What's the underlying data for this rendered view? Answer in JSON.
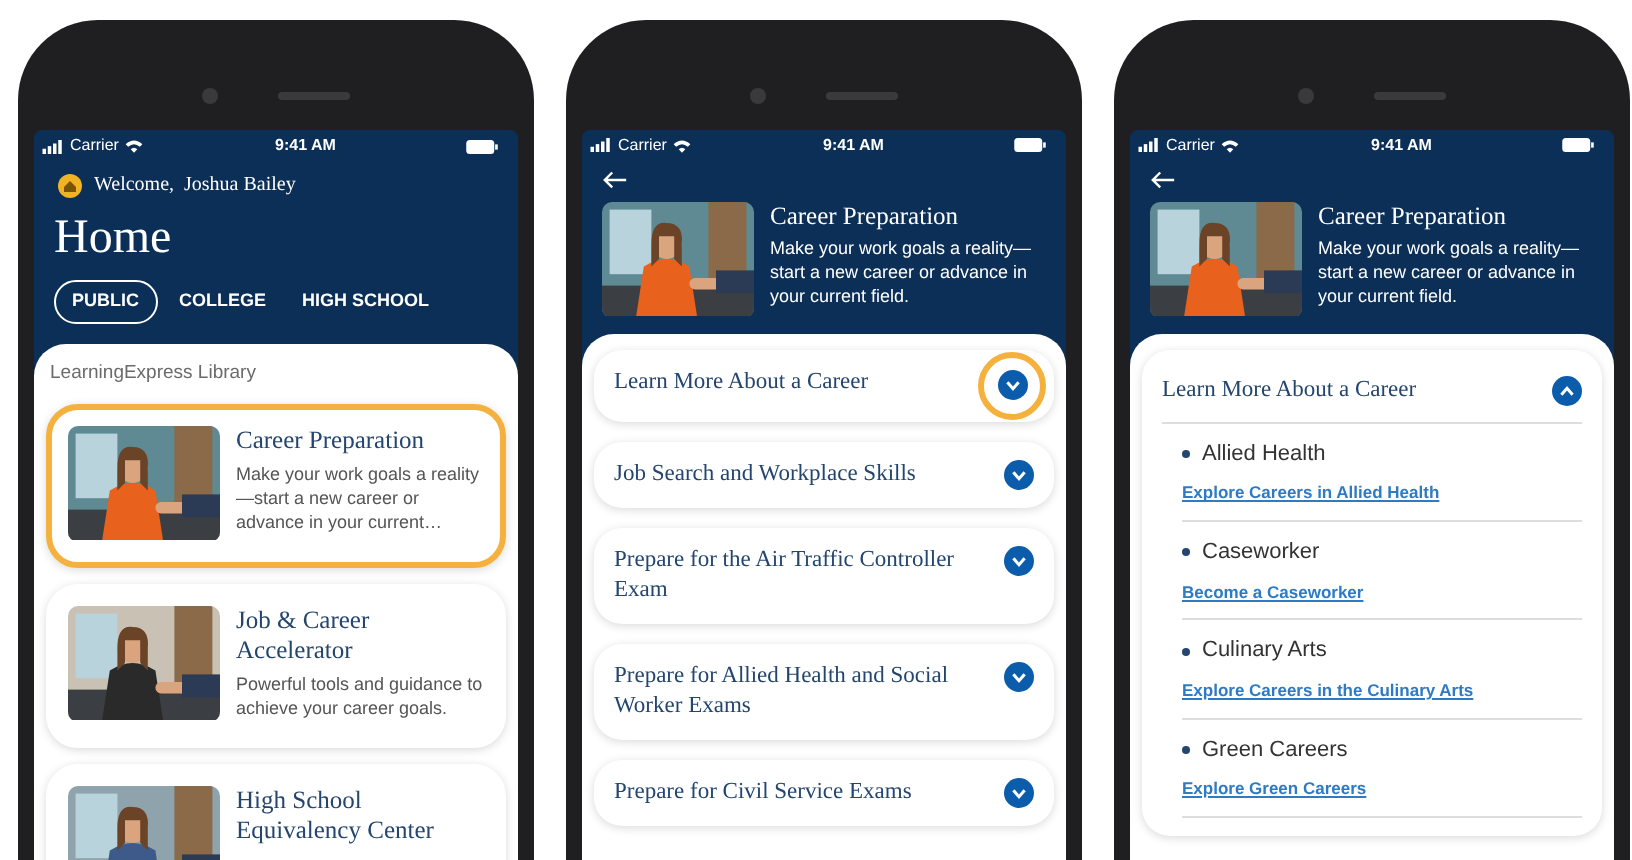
{
  "screens": [
    {
      "kind": "home",
      "status_bar": {
        "carrier": "Carrier",
        "time": "9:41 AM"
      },
      "welcome": "Welcome,  Joshua Bailey",
      "title": "Home",
      "tabs": [
        {
          "label": "PUBLIC",
          "selected": true
        },
        {
          "label": "COLLEGE",
          "selected": false
        },
        {
          "label": "HIGH SCHOOL",
          "selected": false
        }
      ],
      "section_label": "LearningExpress Library",
      "cards": [
        {
          "title": "Career Preparation",
          "description": "Make your work goals a reality—start a new career or advance in your current…",
          "callout": true
        },
        {
          "title": "Job & Career Accelerator",
          "description": "Powerful tools and guidance to achieve your career goals.",
          "callout": false
        },
        {
          "title": "High School Equivalency Center",
          "callout": false
        }
      ]
    },
    {
      "kind": "detail",
      "status_bar": {
        "carrier": "Carrier",
        "time": "9:41 AM"
      },
      "header": {
        "title": "Career Preparation",
        "description": "Make your work goals a reality—start a new career or advance in your current field."
      },
      "sections": [
        {
          "title": "Learn More About a Career",
          "expanded": false,
          "callout": true
        },
        {
          "title": "Job Search and Workplace Skills",
          "expanded": false,
          "callout": false
        },
        {
          "title": "Prepare for the Air Traffic Controller Exam",
          "expanded": false,
          "callout": false
        },
        {
          "title": "Prepare for Allied Health and Social Worker Exams",
          "expanded": false,
          "callout": false
        },
        {
          "title": "Prepare for Civil Service Exams",
          "expanded": false,
          "callout": false
        }
      ]
    },
    {
      "kind": "detail",
      "status_bar": {
        "carrier": "Carrier",
        "time": "9:41 AM"
      },
      "header": {
        "title": "Career Preparation",
        "description": "Make your work goals a reality—start a new career or advance in your current field."
      },
      "sections": [
        {
          "title": "Learn More About a Career",
          "expanded": true,
          "callout": false,
          "items": [
            {
              "name": "Allied Health",
              "link": "Explore Careers in Allied Health"
            },
            {
              "name": "Caseworker",
              "link": "Become a Caseworker"
            },
            {
              "name": "Culinary Arts",
              "link": "Explore Careers in the Culinary Arts"
            },
            {
              "name": "Green Careers",
              "link": "Explore Green Careers"
            }
          ]
        }
      ]
    }
  ]
}
